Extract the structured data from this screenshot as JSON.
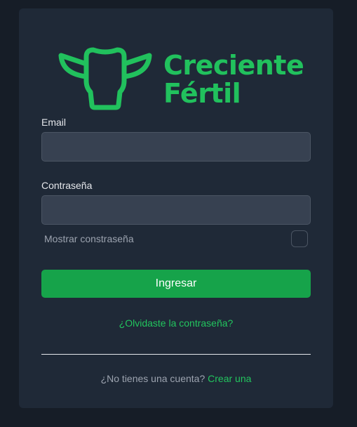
{
  "brand": {
    "line1": "Creciente",
    "line2": "Fértil",
    "color": "#21c15d",
    "icon": "cow-head-icon"
  },
  "form": {
    "email_label": "Email",
    "email_value": "",
    "password_label": "Contraseña",
    "password_value": "",
    "show_password_label": "Mostrar constraseña",
    "show_password_checked": false,
    "submit_label": "Ingresar",
    "forgot_link": "¿Olvidaste la contraseña?"
  },
  "signup": {
    "prompt": "¿No tienes una cuenta?",
    "link": "Crear una"
  },
  "colors": {
    "background": "#161d27",
    "card": "#1f2937",
    "input": "#374151",
    "accent": "#16a34a",
    "link": "#22c55e"
  }
}
